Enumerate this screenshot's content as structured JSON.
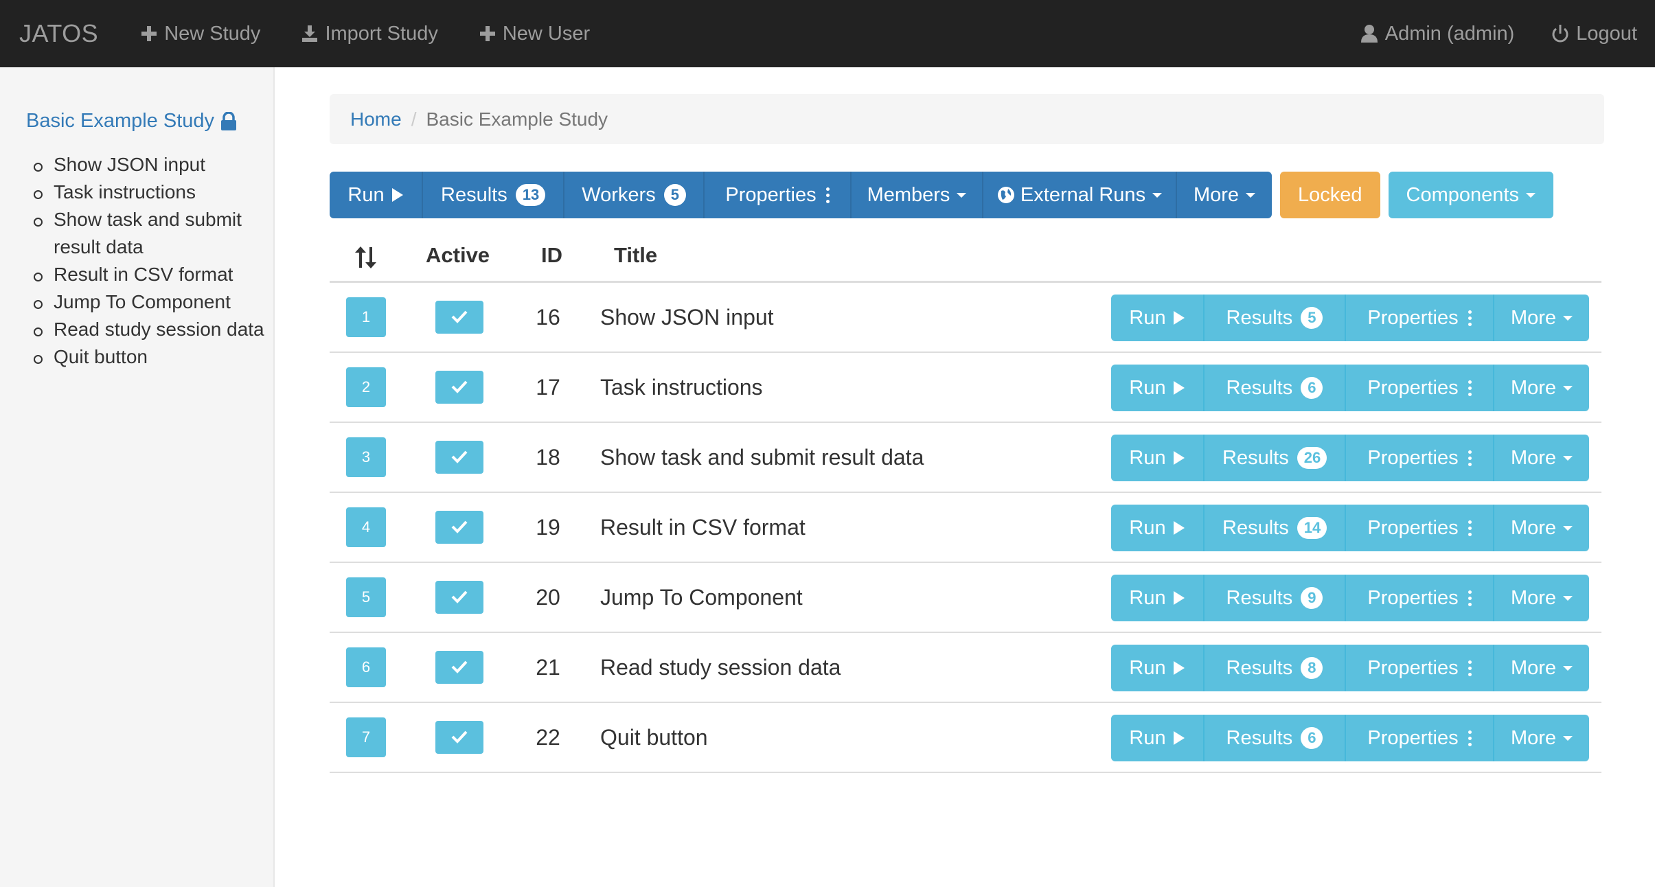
{
  "navbar": {
    "brand": "JATOS",
    "new_study": "New Study",
    "import_study": "Import Study",
    "new_user": "New User",
    "user": "Admin (admin)",
    "logout": "Logout"
  },
  "sidebar": {
    "study_title": "Basic Example Study",
    "components": [
      "Show JSON input",
      "Task instructions",
      "Show task and submit result data",
      "Result in CSV format",
      "Jump To Component",
      "Read study session data",
      "Quit button"
    ]
  },
  "breadcrumb": {
    "home": "Home",
    "separator": "/",
    "current": "Basic Example Study"
  },
  "toolbar": {
    "run": "Run",
    "results": "Results",
    "results_count": "13",
    "workers": "Workers",
    "workers_count": "5",
    "properties": "Properties",
    "members": "Members",
    "external_runs": "External Runs",
    "more": "More",
    "locked": "Locked",
    "components": "Components"
  },
  "table": {
    "headers": {
      "active": "Active",
      "id": "ID",
      "title": "Title"
    },
    "action_labels": {
      "run": "Run",
      "results": "Results",
      "properties": "Properties",
      "more": "More"
    },
    "rows": [
      {
        "position": "1",
        "id": "16",
        "title": "Show JSON input",
        "results": "5"
      },
      {
        "position": "2",
        "id": "17",
        "title": "Task instructions",
        "results": "6"
      },
      {
        "position": "3",
        "id": "18",
        "title": "Show task and submit result data",
        "results": "26"
      },
      {
        "position": "4",
        "id": "19",
        "title": "Result in CSV format",
        "results": "14"
      },
      {
        "position": "5",
        "id": "20",
        "title": "Jump To Component",
        "results": "9"
      },
      {
        "position": "6",
        "id": "21",
        "title": "Read study session data",
        "results": "8"
      },
      {
        "position": "7",
        "id": "22",
        "title": "Quit button",
        "results": "6"
      }
    ]
  },
  "colors": {
    "navbar_bg": "#222222",
    "primary": "#337ab7",
    "info": "#5bc0de",
    "warning": "#f0ad4e"
  }
}
